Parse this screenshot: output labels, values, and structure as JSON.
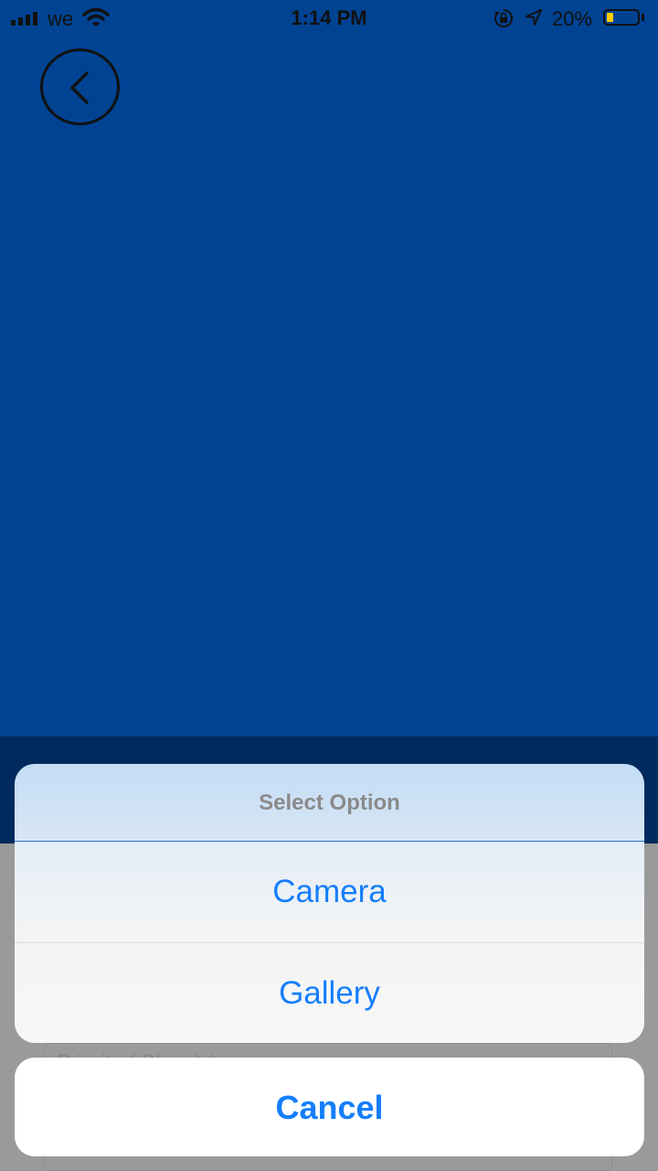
{
  "status_bar": {
    "carrier": "we",
    "time": "1:14 PM",
    "battery_percent": "20%",
    "battery_level": 0.2,
    "battery_color": "#ffcc00"
  },
  "background": {
    "header_color": "#004392"
  },
  "behind_sheet": {
    "field_label": "Priority ( Blues) *"
  },
  "action_sheet": {
    "title": "Select Option",
    "options": [
      "Camera",
      "Gallery"
    ],
    "cancel_label": "Cancel",
    "accent_color": "#157efb"
  }
}
